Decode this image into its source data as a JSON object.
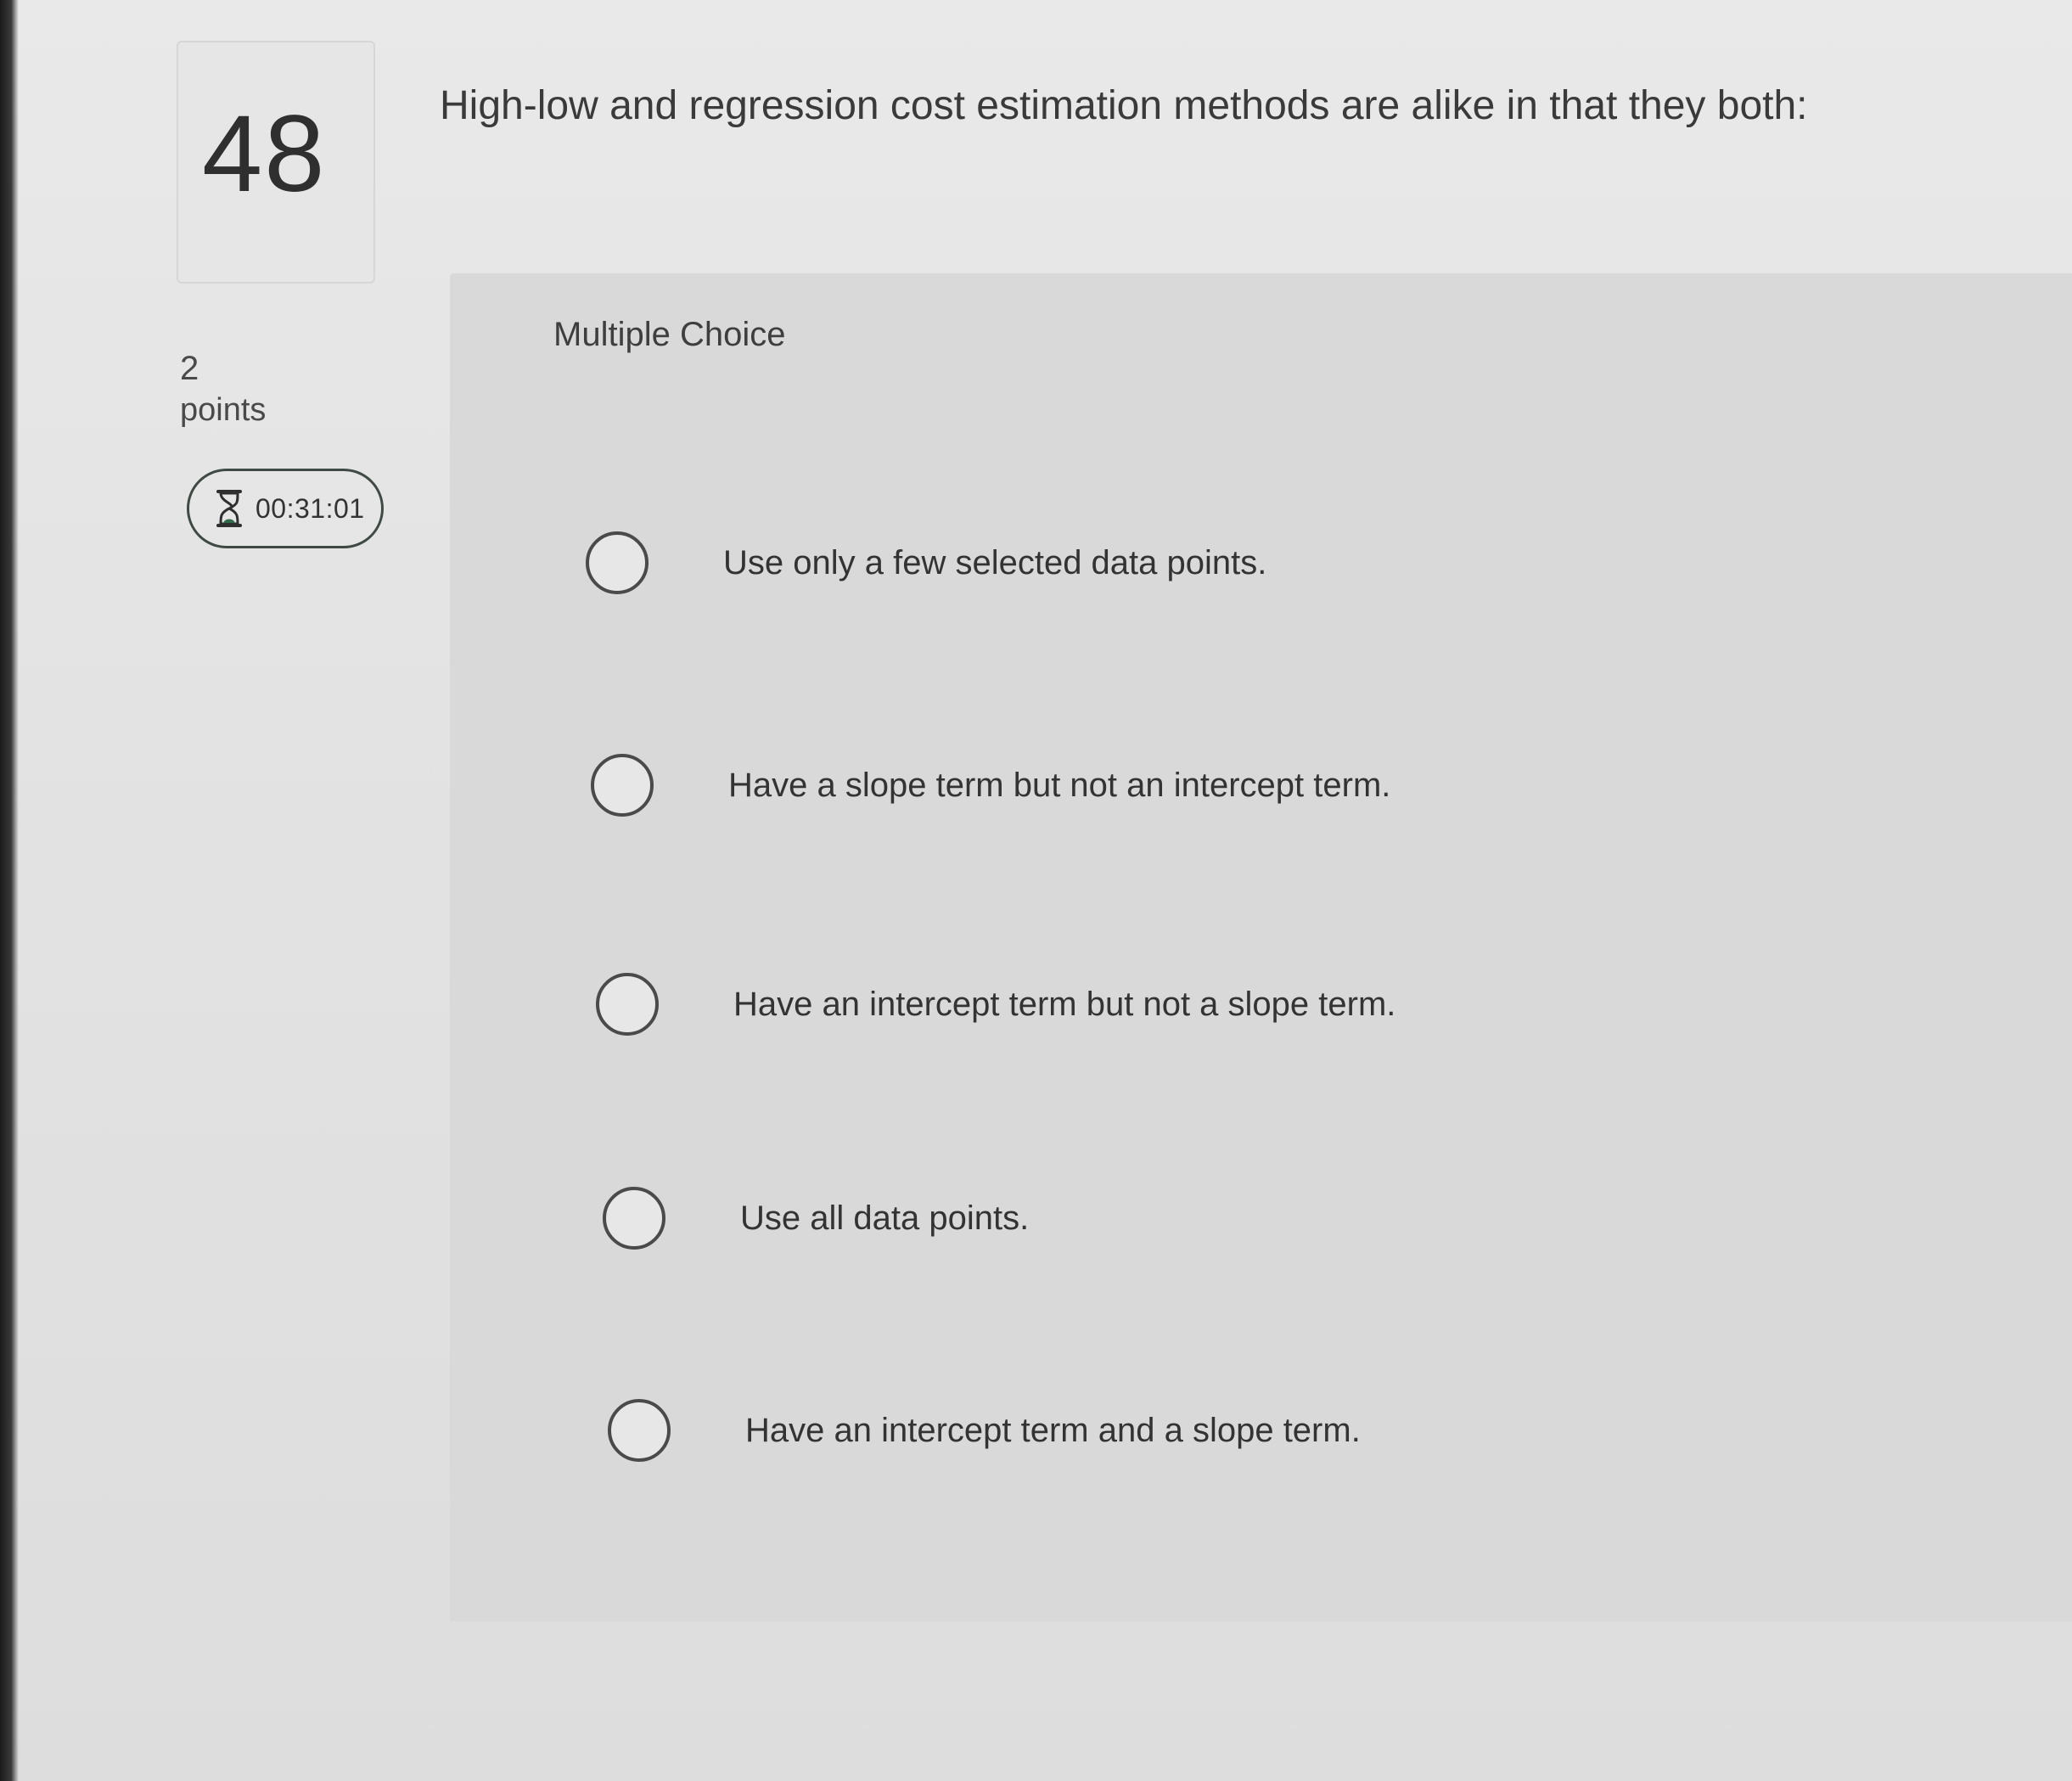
{
  "question": {
    "number": "48",
    "text": "High-low and regression cost estimation methods are alike in that they both:",
    "points_value": "2",
    "points_label": "points",
    "timer": "00:31:01",
    "type": "Multiple Choice"
  },
  "options": [
    {
      "label": "Use only a few selected data points."
    },
    {
      "label": "Have a slope term but not an intercept term."
    },
    {
      "label": "Have an intercept term but not a slope term."
    },
    {
      "label": "Use all data points."
    },
    {
      "label": "Have an intercept term and a slope term."
    }
  ],
  "icons": {
    "timer": "hourglass-icon",
    "option": "radio-button"
  },
  "colors": {
    "background": "#e4e4e4",
    "panel": "#d9d9d9",
    "text": "#333333",
    "timer_border": "#3f4a44"
  }
}
